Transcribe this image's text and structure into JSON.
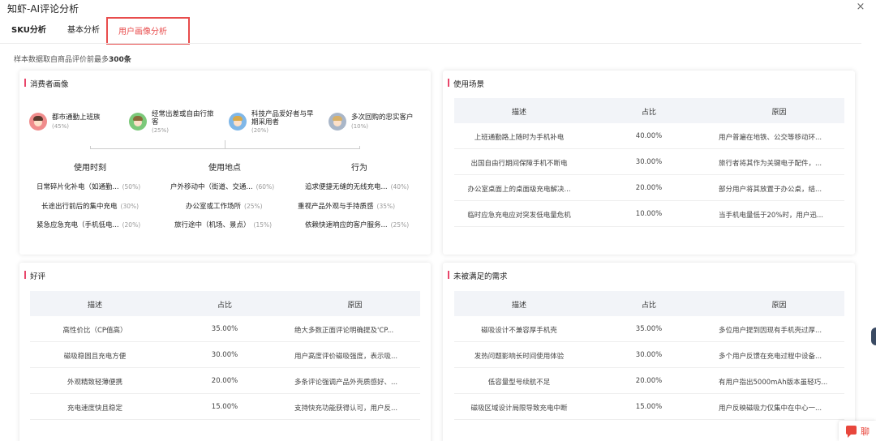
{
  "app_title": "知虾-AI评论分析",
  "close_glyph": "×",
  "tabs": {
    "sku": "SKU分析",
    "basic": "基本分析",
    "user": "用户画像分析"
  },
  "note": {
    "prefix": "样本数据取自商品评价前最多",
    "count": "300条"
  },
  "consumer": {
    "title": "消费者画像",
    "personas": [
      {
        "name": "都市通勤上班族",
        "pct": "(45%)",
        "color": "#f08c8c"
      },
      {
        "name": "经常出差或自由行旅客",
        "pct": "(25%)",
        "color": "#7cc97a"
      },
      {
        "name": "科技产品爱好者与早期采用者",
        "pct": "(20%)",
        "color": "#7fb7e8"
      },
      {
        "name": "多次回购的忠实客户",
        "pct": "(10%)",
        "color": "#a9b6c8"
      }
    ],
    "columns": [
      {
        "head": "使用时刻",
        "items": [
          {
            "text": "日常碎片化补电（如通勤...",
            "pct": "(50%)"
          },
          {
            "text": "长途出行前后的集中充电",
            "pct": "(30%)"
          },
          {
            "text": "紧急应急充电（手机低电...",
            "pct": "(20%)"
          }
        ]
      },
      {
        "head": "使用地点",
        "items": [
          {
            "text": "户外移动中（街道、交通...",
            "pct": "(60%)"
          },
          {
            "text": "办公室或工作场所",
            "pct": "(25%)"
          },
          {
            "text": "旅行途中（机场、景点）",
            "pct": "(15%)"
          }
        ]
      },
      {
        "head": "行为",
        "items": [
          {
            "text": "追求便捷无缝的无线充电...",
            "pct": "(40%)"
          },
          {
            "text": "重视产品外观与手持质感",
            "pct": "(35%)"
          },
          {
            "text": "依赖快速响应的客户服务...",
            "pct": "(25%)"
          }
        ]
      }
    ]
  },
  "scenes": {
    "title": "使用场景",
    "headers": [
      "描述",
      "占比",
      "原因"
    ],
    "rows": [
      [
        "上班通勤路上随时为手机补电",
        "40.00%",
        "用户普遍在地铁、公交等移动环..."
      ],
      [
        "出国自由行期间保障手机不断电",
        "30.00%",
        "旅行者将其作为关键电子配件，..."
      ],
      [
        "办公室桌面上的桌面级充电解决...",
        "20.00%",
        "部分用户将其放置于办公桌，结..."
      ],
      [
        "临时应急充电应对突发低电量危机",
        "10.00%",
        "当手机电量低于20%时，用户迅..."
      ]
    ]
  },
  "praise": {
    "title": "好评",
    "headers": [
      "描述",
      "占比",
      "原因"
    ],
    "rows": [
      [
        "高性价比（CP值高）",
        "35.00%",
        "绝大多数正面评论明确提及'CP..."
      ],
      [
        "磁吸稳固且充电方便",
        "30.00%",
        "用户高度评价磁吸强度，表示吸..."
      ],
      [
        "外观精致轻薄便携",
        "20.00%",
        "多条评论强调产品外壳质感好、..."
      ],
      [
        "充电速度快且稳定",
        "15.00%",
        "支持快充功能获得认可，用户反..."
      ]
    ]
  },
  "unmet": {
    "title": "未被满足的需求",
    "headers": [
      "描述",
      "占比",
      "原因"
    ],
    "rows": [
      [
        "磁吸设计不兼容厚手机壳",
        "35.00%",
        "多位用户提到因现有手机壳过厚..."
      ],
      [
        "发热问题影响长时间使用体验",
        "30.00%",
        "多个用户反馈在充电过程中设备..."
      ],
      [
        "低容量型号续航不足",
        "20.00%",
        "有用户指出5000mAh版本虽轻巧..."
      ],
      [
        "磁吸区域设计局限导致充电中断",
        "15.00%",
        "用户反映磁吸力仅集中在中心一..."
      ]
    ]
  },
  "chat": {
    "label": "聊"
  }
}
